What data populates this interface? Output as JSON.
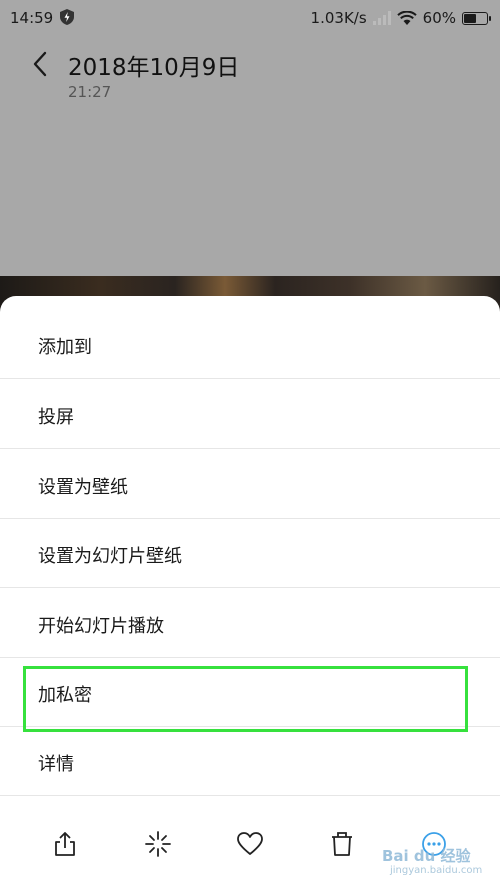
{
  "status_bar": {
    "time": "14:59",
    "network_speed": "1.03K/s",
    "battery": "60%",
    "battery_level": 0.6
  },
  "header": {
    "title": "2018年10月9日",
    "subtitle": "21:27"
  },
  "menu": {
    "items": [
      {
        "label": "添加到"
      },
      {
        "label": "投屏"
      },
      {
        "label": "设置为壁纸"
      },
      {
        "label": "设置为幻灯片壁纸"
      },
      {
        "label": "开始幻灯片播放"
      },
      {
        "label": "加私密"
      },
      {
        "label": "详情"
      }
    ],
    "highlight_color": "#36e13d"
  },
  "toolbar": {
    "icons": [
      "share-icon",
      "sparkle-icon",
      "heart-icon",
      "trash-icon",
      "more-icon"
    ],
    "watermark": "Bai du 经验",
    "watermark_sub": "jingyan.baidu.com"
  }
}
